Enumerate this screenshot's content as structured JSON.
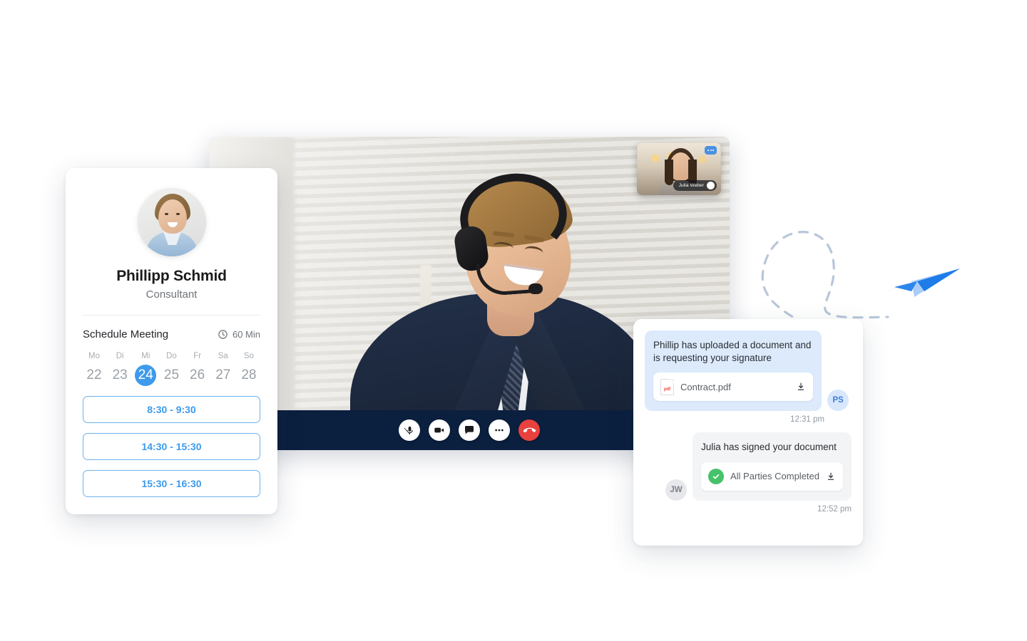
{
  "profile": {
    "name": "Phillipp Schmid",
    "role": "Consultant",
    "avatar_icon": "user-photo-avatar",
    "schedule_label": "Schedule Meeting",
    "duration": "60 Min",
    "clock_icon": "clock-icon",
    "week": [
      {
        "label": "Mo",
        "num": "22",
        "selected": false
      },
      {
        "label": "Di",
        "num": "23",
        "selected": false
      },
      {
        "label": "Mi",
        "num": "24",
        "selected": true
      },
      {
        "label": "Do",
        "num": "25",
        "selected": false
      },
      {
        "label": "Fr",
        "num": "26",
        "selected": false
      },
      {
        "label": "Sa",
        "num": "27",
        "selected": false
      },
      {
        "label": "So",
        "num": "28",
        "selected": false
      }
    ],
    "slots": [
      "8:30 - 9:30",
      "14:30 - 15:30",
      "15:30 - 16:30"
    ]
  },
  "video": {
    "pip_name": "Julia Weber",
    "pip_badge_icon": "info-badge-icon",
    "pip_chip_icon": "more-chip-icon",
    "controls": [
      {
        "name": "microphone-muted-icon",
        "label": "Microphone",
        "style": "light"
      },
      {
        "name": "camera-icon",
        "label": "Camera",
        "style": "light"
      },
      {
        "name": "chat-bubble-icon",
        "label": "Chat",
        "style": "light"
      },
      {
        "name": "more-options-icon",
        "label": "More",
        "style": "light"
      },
      {
        "name": "end-call-icon",
        "label": "End call",
        "style": "end"
      }
    ]
  },
  "chat": {
    "messages": [
      {
        "side": "right",
        "text": "Phillip has uploaded a document and is requesting your signature",
        "attachment_label": "Contract.pdf",
        "attachment_icon": "pdf-file-icon",
        "download_icon": "download-icon",
        "avatar": "PS",
        "time": "12:31 pm"
      },
      {
        "side": "left",
        "text": "Julia has signed your document",
        "attachment_label": "All Parties Completed",
        "attachment_icon": "check-circle-icon",
        "download_icon": "download-icon",
        "avatar": "JW",
        "time": "12:52 pm"
      }
    ]
  },
  "decor": {
    "flight_path_icon": "dashed-flight-path",
    "plane_icon": "paper-plane-icon"
  },
  "colors": {
    "accent_blue": "#3d9aec",
    "bar_navy": "#0b1f3f",
    "end_call_red": "#e8413e",
    "success_green": "#45c26a",
    "bubble_blue": "#dceafb",
    "bubble_gray": "#f3f4f6"
  }
}
